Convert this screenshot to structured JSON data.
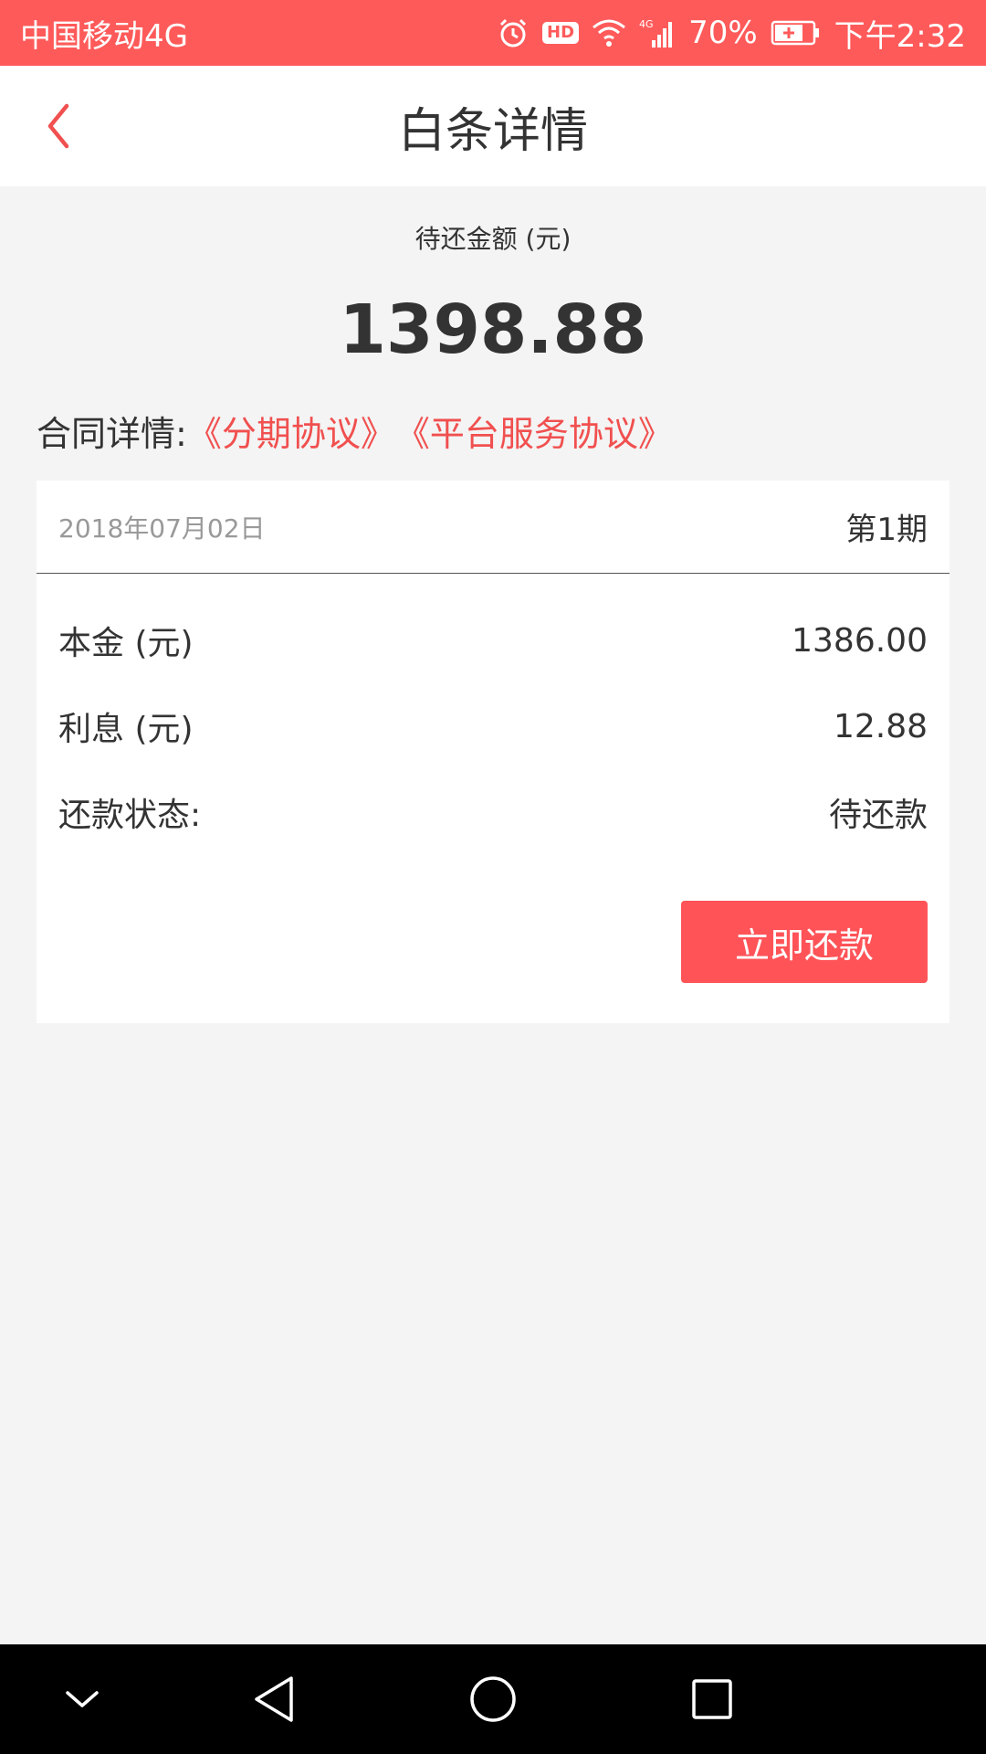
{
  "status_bar": {
    "carrier": "中国移动4G",
    "hd_badge": "HD",
    "network_type": "4G",
    "battery": "70%",
    "time": "下午2:32",
    "icons": [
      "alarm-icon",
      "hd-icon",
      "wifi-icon",
      "signal-icon",
      "battery-icon"
    ]
  },
  "header": {
    "title": "白条详情",
    "back_icon": "chevron-left-icon"
  },
  "summary": {
    "amount_label": "待还金额 (元)",
    "amount_value": "1398.88"
  },
  "contract": {
    "label": "合同详情:",
    "link_installment": "《分期协议》",
    "link_platform": "《平台服务协议》"
  },
  "installment": {
    "date": "2018年07月02日",
    "period": "第1期",
    "principal_label": "本金 (元)",
    "principal_value": "1386.00",
    "interest_label": "利息 (元)",
    "interest_value": "12.88",
    "status_label": "还款状态:",
    "status_value": "待还款",
    "pay_button": "立即还款"
  },
  "colors": {
    "accent": "#ff5a5a",
    "link": "#f0504f",
    "background": "#f4f4f4"
  },
  "system_nav": {
    "icons": [
      "chevron-down-icon",
      "back-triangle-icon",
      "home-circle-icon",
      "recents-square-icon"
    ]
  }
}
